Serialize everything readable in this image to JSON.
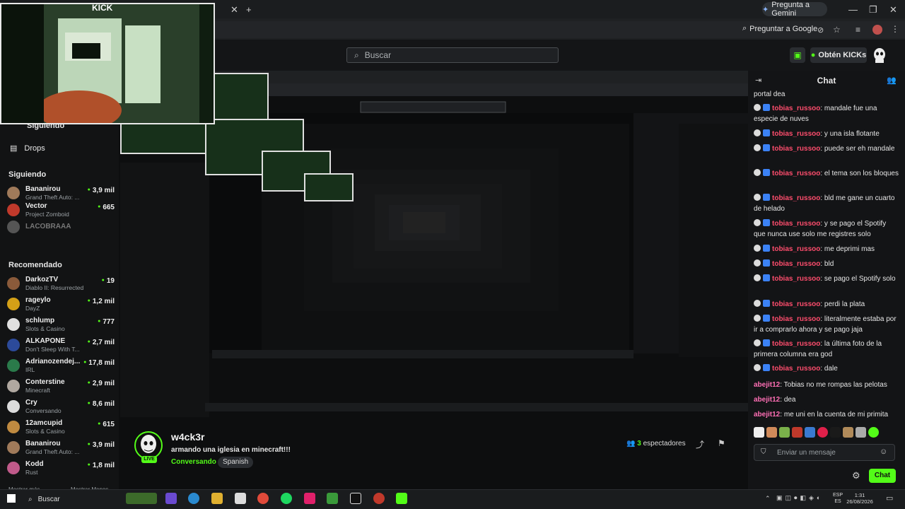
{
  "browser": {
    "gemini_label": "Pregunta a Gemini",
    "ask_google_label": "Preguntar a Google",
    "new_tab_icon": "plus-icon"
  },
  "kick": {
    "webcam_logo": "KICK",
    "search_placeholder": "Buscar",
    "kicks_label": "Obtén KICKs"
  },
  "sidebar": {
    "top_partial": "Siguiendo",
    "drops_label": "Drops",
    "following_title": "Siguiendo",
    "following": [
      {
        "name": "Bananirou",
        "game": "Grand Theft Auto: ...",
        "viewers": "3,9 mil",
        "color": "#a07a5a"
      },
      {
        "name": "Vector",
        "game": "Project Zomboid",
        "viewers": "665",
        "color": "#c0392b"
      },
      {
        "name": "LACOBRAAA",
        "game": "",
        "viewers": "",
        "color": "#555"
      }
    ],
    "recommended_title": "Recomendado",
    "recommended": [
      {
        "name": "DarkozTV",
        "game": "Diablo II: Resurrected",
        "viewers": "19",
        "color": "#8a5a3a"
      },
      {
        "name": "rageylo",
        "game": "DayZ",
        "viewers": "1,2 mil",
        "color": "#d4a017"
      },
      {
        "name": "schlump",
        "game": "Slots & Casino",
        "viewers": "777",
        "color": "#e0e0e0"
      },
      {
        "name": "ALKAPONE",
        "game": "Don't Sleep With T...",
        "viewers": "2,7 mil",
        "color": "#2c4a9a"
      },
      {
        "name": "Adrianozendej...",
        "game": "IRL",
        "viewers": "17,8 mil",
        "color": "#2a7a4a"
      },
      {
        "name": "Conterstine",
        "game": "Minecraft",
        "viewers": "2,9 mil",
        "color": "#b0a8a0"
      },
      {
        "name": "Cry",
        "game": "Conversando",
        "viewers": "8,6 mil",
        "color": "#dcdcdc"
      },
      {
        "name": "12amcupid",
        "game": "Slots & Casino",
        "viewers": "615",
        "color": "#c08a40"
      },
      {
        "name": "Bananirou",
        "game": "Grand Theft Auto: ...",
        "viewers": "3,9 mil",
        "color": "#a07a5a"
      },
      {
        "name": "Kodd",
        "game": "Rust",
        "viewers": "1,8 mil",
        "color": "#c05a8a"
      }
    ],
    "show_more": "Mostrar más",
    "show_less": "Mostrar Menos"
  },
  "chat": {
    "title": "Chat",
    "first_partial": "portal dea",
    "messages": [
      {
        "user": "tobias_russoo",
        "text": "mandale fue una especie de nuves",
        "color": "#ff4d6d"
      },
      {
        "user": "tobias_russoo",
        "text": "y una isla flotante",
        "color": "#ff4d6d"
      },
      {
        "user": "tobias_russoo",
        "text": "puede ser eh mandale",
        "color": "#ff4d6d"
      },
      {
        "user": "tobias_russoo",
        "text": "el tema son los bloques",
        "color": "#ff4d6d"
      },
      {
        "user": "tobias_russoo",
        "text": "bld me gane un cuarto de helado",
        "color": "#ff4d6d"
      },
      {
        "user": "tobias_russoo",
        "text": "y se pago el Spotify que nunca use solo me registres solo",
        "color": "#ff4d6d"
      },
      {
        "user": "tobias_russoo",
        "text": "me deprimi mas",
        "color": "#ff4d6d"
      },
      {
        "user": "tobias_russoo",
        "text": "bld",
        "color": "#ff4d6d"
      },
      {
        "user": "tobias_russoo",
        "text": "se pago el Spotify solo",
        "color": "#ff4d6d"
      },
      {
        "user": "tobias_russoo",
        "text": "perdi la plata",
        "color": "#ff4d6d"
      },
      {
        "user": "tobias_russoo",
        "text": "literalmente estaba por ir a comprarlo ahora y se pago jaja",
        "color": "#ff4d6d"
      },
      {
        "user": "tobias_russoo",
        "text": "la última foto de la primera columna era god",
        "color": "#ff4d6d"
      },
      {
        "user": "tobias_russoo",
        "text": "dale",
        "color": "#ff4d6d"
      },
      {
        "user": "abejit12",
        "text": "Tobias no me rompas las pelotas",
        "color": "#ff6fb5"
      },
      {
        "user": "abejit12",
        "text": "dea",
        "color": "#ff6fb5"
      },
      {
        "user": "abejit12",
        "text": "me uni en la cuenta de mi primita",
        "color": "#ff6fb5"
      }
    ],
    "input_placeholder": "Enviar un mensaje",
    "send_label": "Chat"
  },
  "stream": {
    "streamer": "w4ck3r",
    "live_badge": "LIVE",
    "title": "armando una iglesia en minecraft!!!",
    "category": "Conversando",
    "tag": "Spanish",
    "viewers_count": "3",
    "viewers_label": "espectadores"
  },
  "taskbar": {
    "search_label": "Buscar",
    "lang_top": "ESP",
    "lang_bottom": "ES",
    "time": "1:31",
    "date": "26/08/2026"
  },
  "colors": {
    "accent": "#53fc18",
    "chat_user_pink": "#ff4d6d"
  }
}
